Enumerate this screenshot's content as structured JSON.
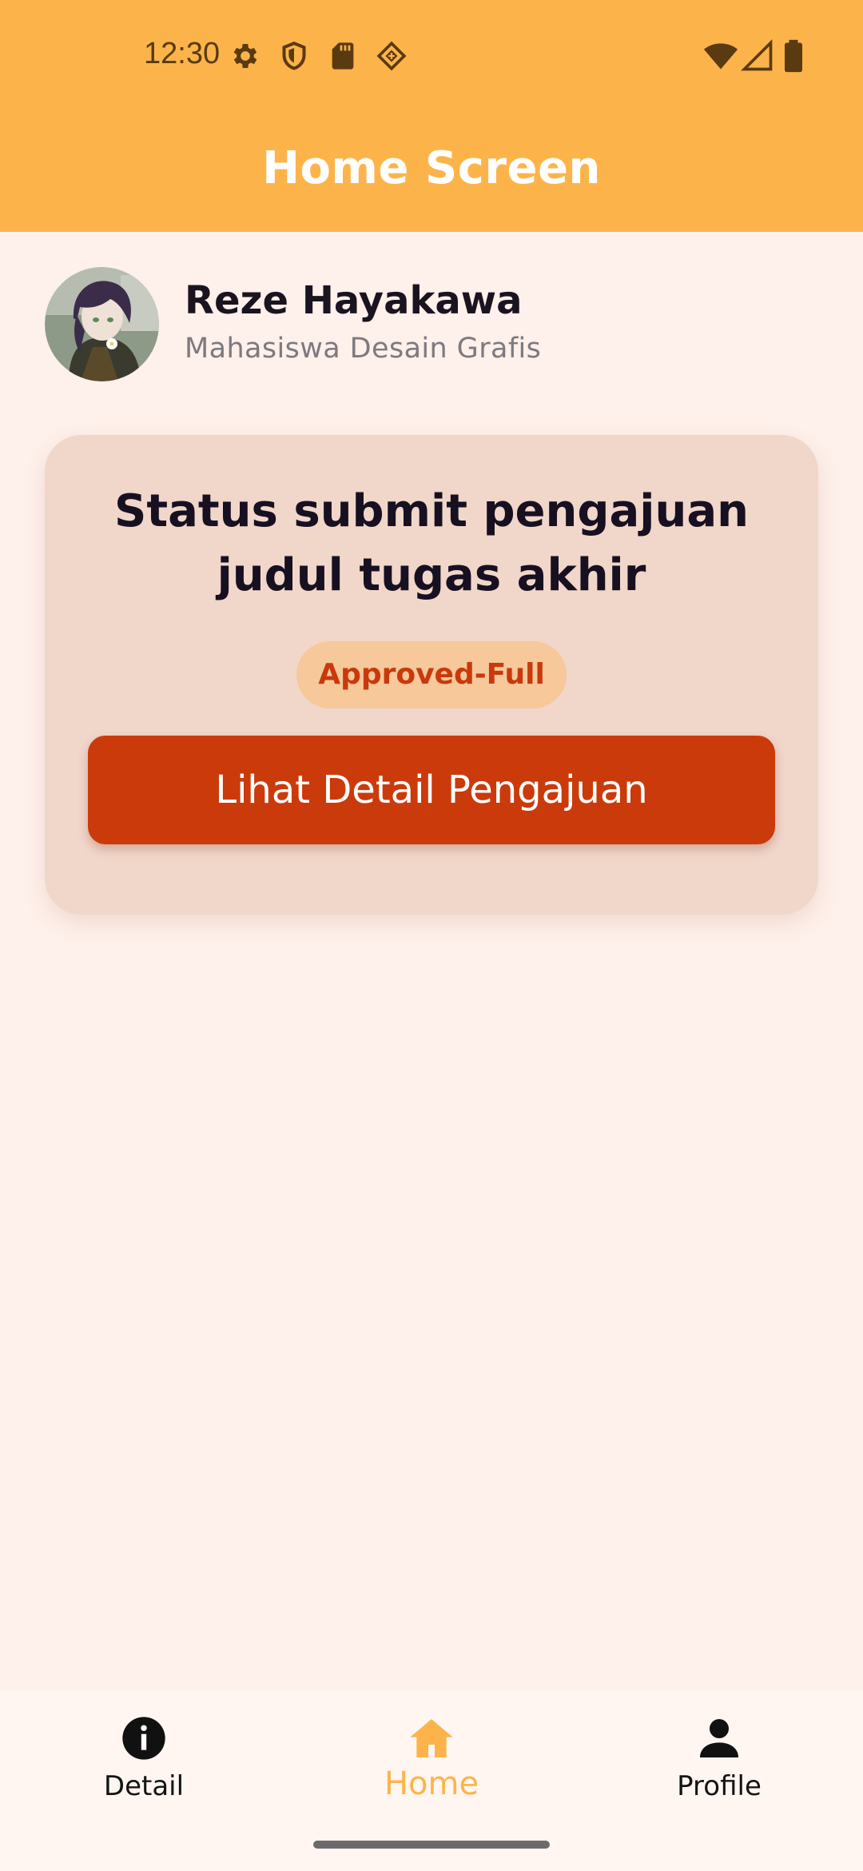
{
  "status_bar": {
    "time": "12:30",
    "left_icons": [
      "gear-icon",
      "shield-icon",
      "sd-card-icon",
      "diamond-icon"
    ],
    "right_icons": [
      "wifi-icon",
      "signal-icon",
      "battery-icon"
    ]
  },
  "app_bar": {
    "title": "Home Screen",
    "color": "#fcb44a"
  },
  "profile": {
    "name": "Reze Hayakawa",
    "role": "Mahasiswa Desain Grafis"
  },
  "submission_card": {
    "title_line1": "Status submit pengajuan",
    "title_line2": "judul tugas akhir",
    "status": "Approved-Full",
    "button_label": "Lihat Detail Pengajuan",
    "button_color": "#cb3a0b",
    "badge_color": "#f6c89a"
  },
  "bottom_nav": {
    "items": [
      {
        "label": "Detail",
        "icon": "info-icon"
      },
      {
        "label": "Home",
        "icon": "home-icon",
        "active": true
      },
      {
        "label": "Profile",
        "icon": "person-icon"
      }
    ],
    "active_color": "#fcb44a"
  }
}
